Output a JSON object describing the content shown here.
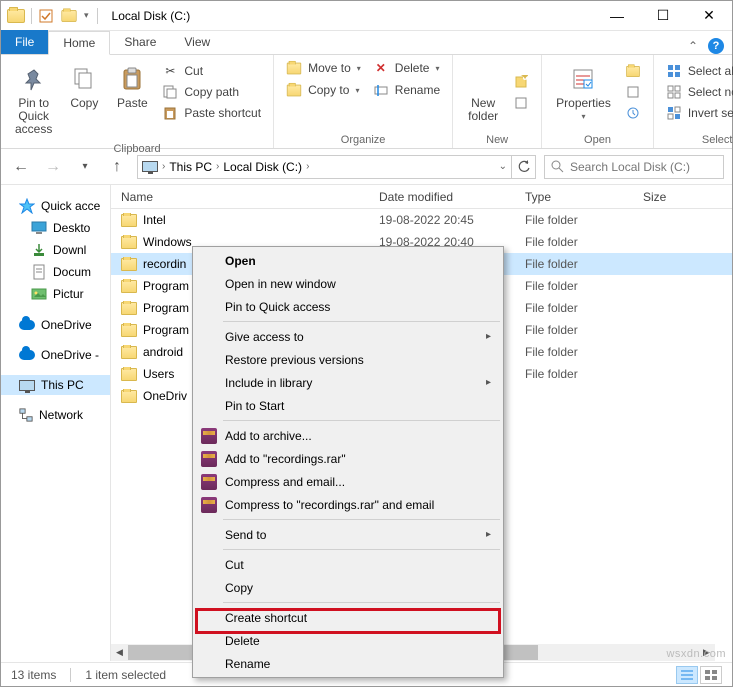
{
  "window": {
    "title": "Local Disk (C:)"
  },
  "tabs": {
    "file": "File",
    "home": "Home",
    "share": "Share",
    "view": "View"
  },
  "ribbon": {
    "pin": "Pin to Quick\naccess",
    "copy": "Copy",
    "paste": "Paste",
    "cut": "Cut",
    "copypath": "Copy path",
    "pasteshortcut": "Paste shortcut",
    "clipboard_group": "Clipboard",
    "moveto": "Move to",
    "copyto": "Copy to",
    "delete": "Delete",
    "rename": "Rename",
    "organize_group": "Organize",
    "newfolder": "New\nfolder",
    "new_group": "New",
    "properties": "Properties",
    "open_group": "Open",
    "selectall": "Select all",
    "selectnone": "Select none",
    "invert": "Invert selection",
    "select_group": "Select"
  },
  "breadcrumb": {
    "pc": "This PC",
    "loc": "Local Disk (C:)"
  },
  "search": {
    "placeholder": "Search Local Disk (C:)"
  },
  "nav": {
    "quick": "Quick acce",
    "desktop": "Deskto",
    "downloads": "Downl",
    "documents": "Docum",
    "pictures": "Pictur",
    "onedrive": "OneDrive",
    "onedrive2": "OneDrive -",
    "thispc": "This PC",
    "network": "Network"
  },
  "columns": {
    "name": "Name",
    "date": "Date modified",
    "type": "Type",
    "size": "Size"
  },
  "rows": [
    {
      "name": "Intel",
      "date": "19-08-2022 20:45",
      "type": "File folder"
    },
    {
      "name": "Windows",
      "date": "19-08-2022 20:40",
      "type": "File folder"
    },
    {
      "name": "recordin",
      "date": "",
      "type": "File folder"
    },
    {
      "name": "Program",
      "date": "",
      "type": "File folder"
    },
    {
      "name": "Program",
      "date": "",
      "type": "File folder"
    },
    {
      "name": "Program",
      "date": "",
      "type": "File folder"
    },
    {
      "name": "android",
      "date": "",
      "type": "File folder"
    },
    {
      "name": "Users",
      "date": "",
      "type": "File folder"
    },
    {
      "name": "OneDriv",
      "date": "",
      "type": ""
    }
  ],
  "context": {
    "open": "Open",
    "newwin": "Open in new window",
    "pin": "Pin to Quick access",
    "giveaccess": "Give access to",
    "restore": "Restore previous versions",
    "include": "Include in library",
    "pinstart": "Pin to Start",
    "addarchive": "Add to archive...",
    "addrar": "Add to \"recordings.rar\"",
    "compressemail": "Compress and email...",
    "compressraremail": "Compress to \"recordings.rar\" and email",
    "sendto": "Send to",
    "cut": "Cut",
    "copy": "Copy",
    "shortcut": "Create shortcut",
    "delete": "Delete",
    "rename": "Rename"
  },
  "status": {
    "items": "13 items",
    "selected": "1 item selected"
  },
  "watermark": "wsxdn.com"
}
